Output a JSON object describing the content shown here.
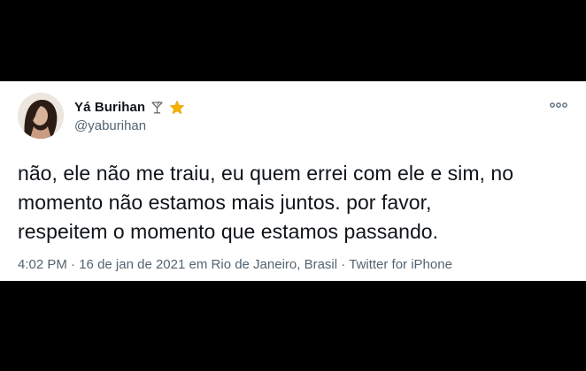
{
  "tweet": {
    "author": {
      "display_name": "Yá Burihan",
      "handle": "@yaburihan",
      "name_emojis": [
        "cocktail-glass-icon",
        "star-icon"
      ]
    },
    "text_lines": [
      "não, ele não me traiu, eu quem errei com ele e sim, no",
      "momento não estamos mais juntos. por favor,",
      "respeitem o momento que estamos passando."
    ],
    "meta": {
      "time": "4:02 PM",
      "separator": "·",
      "date": "16 de jan de 2021",
      "location_prefix": "em",
      "location": "Rio de Janeiro, Brasil",
      "source": "Twitter for iPhone"
    }
  },
  "colors": {
    "background": "#000000",
    "card": "#ffffff",
    "primary_text": "#0f1419",
    "secondary_text": "#536471",
    "star": "#f4b400"
  }
}
